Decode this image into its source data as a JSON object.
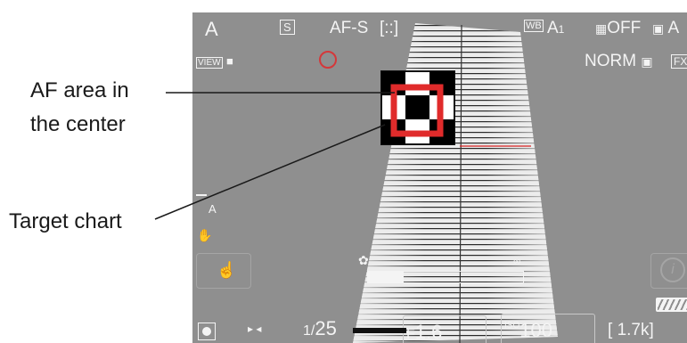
{
  "callouts": {
    "af_area_line1": "AF area in",
    "af_area_line2": "the center",
    "target_chart": "Target chart"
  },
  "top_bar": {
    "shooting_mode": "A",
    "release_mode": "S",
    "focus_mode": "AF-S",
    "af_area_mode": "[::]",
    "wb_badge": "WB",
    "wb_value": "A",
    "wb_sub": "1",
    "adl": "OFF",
    "picture_control": "A"
  },
  "second_row": {
    "view_badge": "VIEW",
    "image_quality": "NORM",
    "image_area": "FX"
  },
  "bottom_bar": {
    "shutter_prefix": "1/",
    "shutter_value": "25",
    "aperture_prefix": "F",
    "aperture_value": "1.6",
    "iso_label": "ISO",
    "iso_value": "100",
    "shots_remaining": "1.7k"
  },
  "exposure_indicator": {
    "label": "A"
  },
  "colors": {
    "lcd_bg": "#8f8f8f",
    "hud_text": "#f4f4f4",
    "af_frame": "#e02b2b",
    "chart_paper": "#ececec"
  },
  "icons": [
    "camera-icon",
    "self-timer-icon",
    "metering-icon",
    "info-icon",
    "battery-icon",
    "touch-shutter-icon",
    "vr-hand-icon"
  ]
}
